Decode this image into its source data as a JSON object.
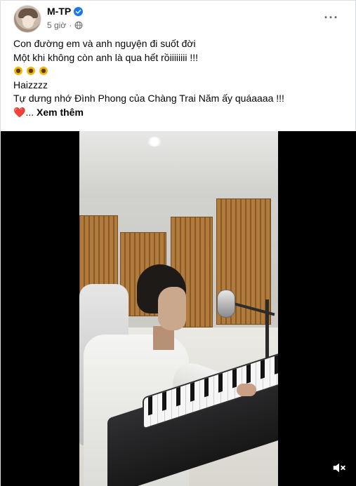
{
  "post": {
    "author": "M-TP",
    "timestamp": "5 giờ",
    "privacy_icon": "globe-icon",
    "more_icon": "more-horizontal-icon",
    "text_lines": [
      "Con đường em và anh nguyện đi suốt đời",
      "Một khi không còn anh là qua hết rồiiiiiiii !!!",
      "Haizzzz",
      "Tự dưng nhớ Đình Phong của Chàng Trai Năm ấy quáaaaa !!!"
    ],
    "emoji_line_icons": [
      "sunflower-icon",
      "sunflower-icon",
      "sunflower-icon"
    ],
    "see_more_prefix": "...",
    "see_more_label": "Xem thêm",
    "colors": {
      "verified": "#1877f2",
      "heart": "#e41e3f",
      "meta_text": "#65676b"
    }
  },
  "video": {
    "mute_icon": "volume-muted-icon"
  }
}
